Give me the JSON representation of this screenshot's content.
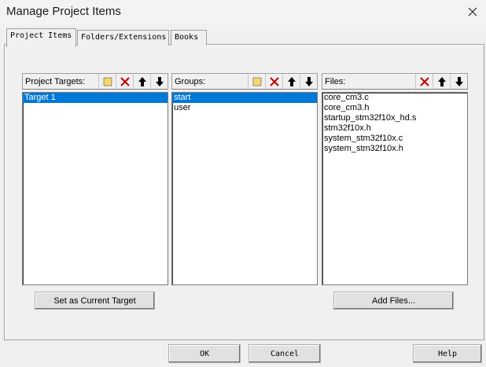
{
  "window": {
    "title": "Manage Project Items"
  },
  "tabs": [
    {
      "label": "Project Items",
      "active": true
    },
    {
      "label": "Folders/Extensions",
      "active": false
    },
    {
      "label": "Books",
      "active": false
    }
  ],
  "targets": {
    "header": "Project Targets:",
    "items": [
      "Target 1"
    ],
    "selected_index": 0,
    "button_label": "Set as Current Target"
  },
  "groups": {
    "header": "Groups:",
    "items": [
      "start",
      "user"
    ],
    "selected_index": 0
  },
  "files": {
    "header": "Files:",
    "items": [
      "core_cm3.c",
      "core_cm3.h",
      "startup_stm32f10x_hd.s",
      "stm32f10x.h",
      "system_stm32f10x.c",
      "system_stm32f10x.h"
    ],
    "button_label": "Add Files..."
  },
  "footer": {
    "ok": "OK",
    "cancel": "Cancel",
    "help": "Help"
  },
  "colors": {
    "selection": "#0078d7",
    "delete_red": "#c00000",
    "new_folder_yellow": "#f5d76e"
  }
}
